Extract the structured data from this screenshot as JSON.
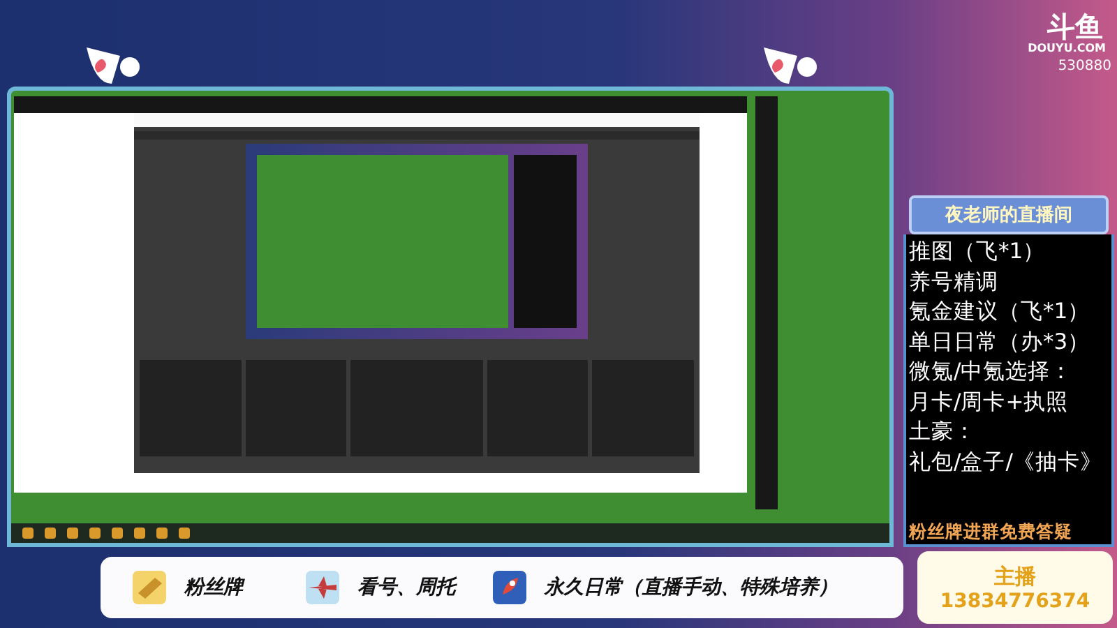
{
  "logo": {
    "name": "斗鱼",
    "site": "DOUYU.COM",
    "room": "530880"
  },
  "panel": {
    "title": "夜老师的直播间",
    "items": [
      "推图（飞*1）",
      "养号精调",
      "氪金建议（飞*1）",
      "单日日常（办*3）",
      "微氪/中氪选择：",
      "月卡/周卡+执照",
      "土豪：",
      "礼包/盒子/《抽卡》"
    ],
    "footer": "粉丝牌进群免费答疑"
  },
  "host": {
    "label": "主播",
    "phone": "13834776374"
  },
  "banner": {
    "items": [
      {
        "kind": "medal",
        "text": "粉丝牌"
      },
      {
        "kind": "plane",
        "text": "看号、周托"
      },
      {
        "kind": "rocket",
        "text": "永久日常（直播手动、特殊培养）"
      }
    ]
  }
}
